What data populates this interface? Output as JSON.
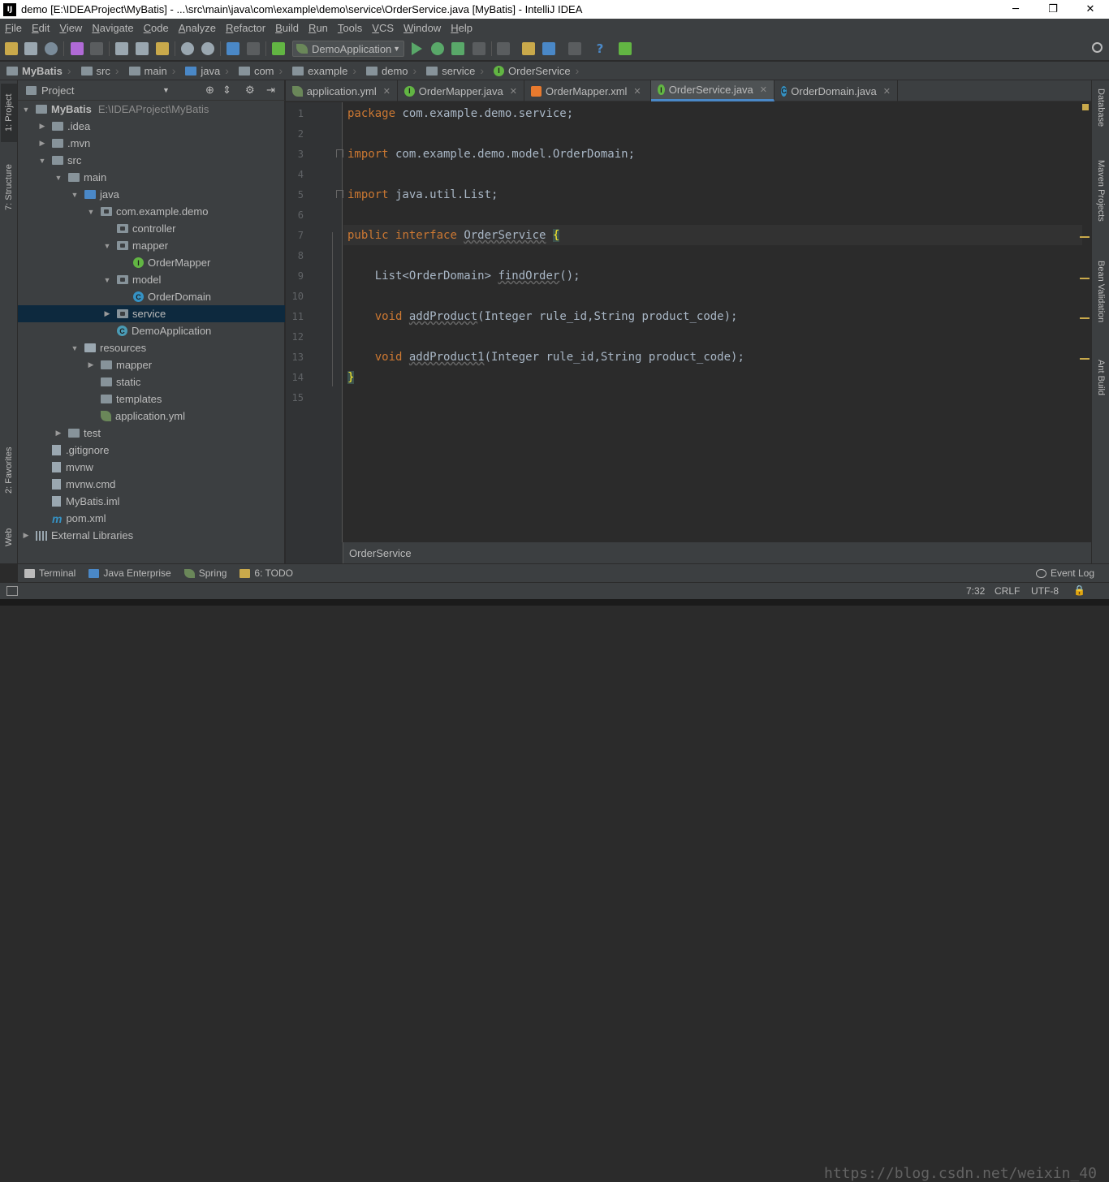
{
  "window": {
    "title": "demo [E:\\IDEAProject\\MyBatis] - ...\\src\\main\\java\\com\\example\\demo\\service\\OrderService.java [MyBatis] - IntelliJ IDEA"
  },
  "menu": [
    "File",
    "Edit",
    "View",
    "Navigate",
    "Code",
    "Analyze",
    "Refactor",
    "Build",
    "Run",
    "Tools",
    "VCS",
    "Window",
    "Help"
  ],
  "toolbar": {
    "run_config": "DemoApplication"
  },
  "breadcrumbs": [
    "MyBatis",
    "src",
    "main",
    "java",
    "com",
    "example",
    "demo",
    "service",
    "OrderService"
  ],
  "left_tool_tabs": {
    "project": "1: Project",
    "structure": "7: Structure",
    "favorites": "2: Favorites",
    "web": "Web"
  },
  "right_tool_tabs": {
    "database": "Database",
    "maven": "Maven Projects",
    "bean": "Bean Validation",
    "ant": "Ant Build"
  },
  "project_panel": {
    "title": "Project",
    "tree": [
      {
        "label": "MyBatis",
        "path": "E:\\IDEAProject\\MyBatis",
        "depth": 0,
        "toggle": "▼",
        "kind": "module"
      },
      {
        "label": ".idea",
        "depth": 1,
        "toggle": "▶",
        "kind": "folder"
      },
      {
        "label": ".mvn",
        "depth": 1,
        "toggle": "▶",
        "kind": "folder"
      },
      {
        "label": "src",
        "depth": 1,
        "toggle": "▼",
        "kind": "folder"
      },
      {
        "label": "main",
        "depth": 2,
        "toggle": "▼",
        "kind": "folder"
      },
      {
        "label": "java",
        "depth": 3,
        "toggle": "▼",
        "kind": "folder"
      },
      {
        "label": "com.example.demo",
        "depth": 4,
        "toggle": "▼",
        "kind": "pkg"
      },
      {
        "label": "controller",
        "depth": 5,
        "toggle": "",
        "kind": "pkg"
      },
      {
        "label": "mapper",
        "depth": 5,
        "toggle": "▼",
        "kind": "pkg"
      },
      {
        "label": "OrderMapper",
        "depth": 6,
        "toggle": "",
        "kind": "interface"
      },
      {
        "label": "model",
        "depth": 5,
        "toggle": "▼",
        "kind": "pkg"
      },
      {
        "label": "OrderDomain",
        "depth": 6,
        "toggle": "",
        "kind": "class"
      },
      {
        "label": "service",
        "depth": 5,
        "toggle": "▶",
        "kind": "pkg",
        "selected": true
      },
      {
        "label": "DemoApplication",
        "depth": 5,
        "toggle": "",
        "kind": "app"
      },
      {
        "label": "resources",
        "depth": 3,
        "toggle": "▼",
        "kind": "folder"
      },
      {
        "label": "mapper",
        "depth": 4,
        "toggle": "▶",
        "kind": "folder"
      },
      {
        "label": "static",
        "depth": 4,
        "toggle": "",
        "kind": "folder"
      },
      {
        "label": "templates",
        "depth": 4,
        "toggle": "",
        "kind": "folder"
      },
      {
        "label": "application.yml",
        "depth": 4,
        "toggle": "",
        "kind": "yml"
      },
      {
        "label": "test",
        "depth": 2,
        "toggle": "▶",
        "kind": "folder"
      },
      {
        "label": ".gitignore",
        "depth": 1,
        "toggle": "",
        "kind": "file"
      },
      {
        "label": "mvnw",
        "depth": 1,
        "toggle": "",
        "kind": "file"
      },
      {
        "label": "mvnw.cmd",
        "depth": 1,
        "toggle": "",
        "kind": "file"
      },
      {
        "label": "MyBatis.iml",
        "depth": 1,
        "toggle": "",
        "kind": "file"
      },
      {
        "label": "pom.xml",
        "depth": 1,
        "toggle": "",
        "kind": "maven"
      },
      {
        "label": "External Libraries",
        "depth": 0,
        "toggle": "▶",
        "kind": "libs"
      }
    ]
  },
  "editor_tabs": [
    {
      "label": "application.yml",
      "icon": "yml"
    },
    {
      "label": "OrderMapper.java",
      "icon": "interface"
    },
    {
      "label": "OrderMapper.xml",
      "icon": "xml"
    },
    {
      "label": "OrderService.java",
      "icon": "interface",
      "active": true
    },
    {
      "label": "OrderDomain.java",
      "icon": "class"
    }
  ],
  "code_lines": [
    "1",
    "2",
    "3",
    "4",
    "5",
    "6",
    "7",
    "8",
    "9",
    "10",
    "11",
    "12",
    "13",
    "14",
    "15"
  ],
  "code": {
    "l1a": "package",
    "l1b": " com.example.demo.service;",
    "l3a": "import",
    "l3b": " com.example.demo.model.OrderDomain;",
    "l5a": "import",
    "l5b": " java.util.List;",
    "l7a": "public",
    "l7b": " ",
    "l7c": "interface",
    "l7d": " ",
    "l7e": "OrderService",
    "l7f": " ",
    "l7g": "{",
    "l9a": "    List<OrderDomain> ",
    "l9b": "findOrder",
    "l9c": "();",
    "l11a": "    ",
    "l11b": "void",
    "l11c": " ",
    "l11d": "addProduct",
    "l11e": "(Integer rule_id,String product_code);",
    "l13a": "    ",
    "l13b": "void",
    "l13c": " ",
    "l13d": "addProduct1",
    "l13e": "(Integer rule_id,String product_code);",
    "l14a": "}"
  },
  "editor_breadcrumb": "OrderService",
  "bottom_tabs": [
    {
      "label": "Terminal"
    },
    {
      "label": "Java Enterprise"
    },
    {
      "label": "Spring"
    },
    {
      "label": "6: TODO"
    }
  ],
  "event_log": "Event Log",
  "status": {
    "position": "7:32",
    "line_sep": "CRLF",
    "encoding": "UTF-8"
  },
  "watermark": "https://blog.csdn.net/weixin_40"
}
